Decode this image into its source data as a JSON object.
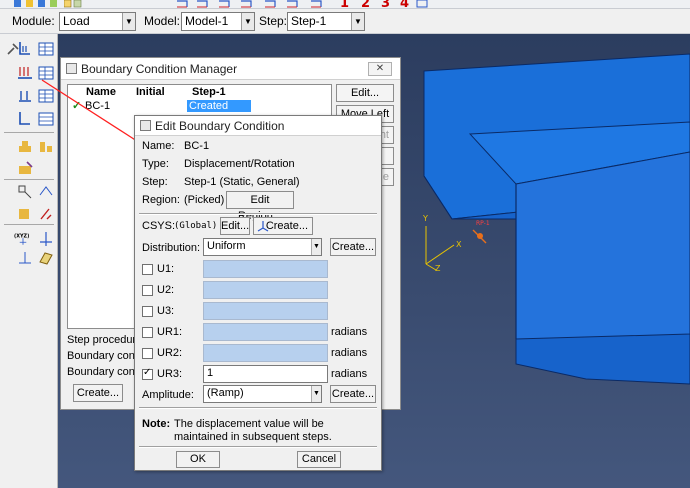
{
  "toolbar": {
    "step_numbers": [
      "1",
      "2",
      "3",
      "4"
    ]
  },
  "context": {
    "module_label": "Module:",
    "module_value": "Load",
    "model_label": "Model:",
    "model_value": "Model-1",
    "step_label": "Step:",
    "step_value": "Step-1"
  },
  "viewport": {
    "axes": {
      "y": "Y",
      "x": "X",
      "z": "Z"
    },
    "bc_marker_label": "RP-1",
    "colors": {
      "part": "#1a6fd9",
      "part_edge": "#0a2a66",
      "background": "#33466a"
    }
  },
  "bc_manager": {
    "title": "Boundary Condition Manager",
    "columns": [
      "Name",
      "Initial",
      "Step-1"
    ],
    "rows": [
      {
        "check": "✓",
        "name": "BC-1",
        "initial": "",
        "step1": "Created"
      }
    ],
    "buttons": {
      "edit": "Edit...",
      "move_left": "Move Left",
      "partial_1": "ht",
      "partial_2": "e"
    },
    "status_lines": [
      "Step procedur",
      "Boundary cond",
      "Boundary cond"
    ],
    "create_button": "Create..."
  },
  "edit_bc": {
    "title": "Edit Boundary Condition",
    "name_label": "Name:",
    "name_value": "BC-1",
    "type_label": "Type:",
    "type_value": "Displacement/Rotation",
    "step_label": "Step:",
    "step_value": "Step-1 (Static, General)",
    "region_label": "Region:",
    "region_value": "(Picked)",
    "edit_region_button": "Edit Region...",
    "csys_label": "CSYS:",
    "csys_value": "(Global)",
    "csys_edit_button": "Edit...",
    "csys_create_button": "Create...",
    "distribution_label": "Distribution:",
    "distribution_value": "Uniform",
    "distribution_create_button": "Create...",
    "dofs": [
      {
        "label": "U1:",
        "checked": false,
        "value": "",
        "unit": ""
      },
      {
        "label": "U2:",
        "checked": false,
        "value": "",
        "unit": ""
      },
      {
        "label": "U3:",
        "checked": false,
        "value": "",
        "unit": ""
      },
      {
        "label": "UR1:",
        "checked": false,
        "value": "",
        "unit": "radians"
      },
      {
        "label": "UR2:",
        "checked": false,
        "value": "",
        "unit": "radians"
      },
      {
        "label": "UR3:",
        "checked": true,
        "value": "1",
        "unit": "radians"
      }
    ],
    "amplitude_label": "Amplitude:",
    "amplitude_value": "(Ramp)",
    "amplitude_create_button": "Create...",
    "note_label": "Note:",
    "note_line1": "The displacement value will be",
    "note_line2": "maintained in subsequent steps.",
    "ok_button": "OK",
    "cancel_button": "Cancel"
  }
}
